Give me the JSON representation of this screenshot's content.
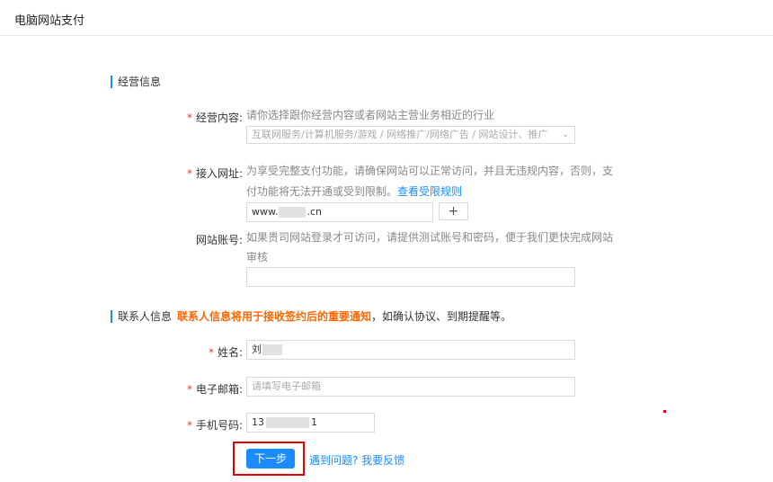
{
  "header": {
    "title": "电脑网站支付"
  },
  "business_section": {
    "title": "经营信息"
  },
  "business_content": {
    "required_mark": "*",
    "label": "经营内容:",
    "hint": "请你选择跟你经营内容或者网站主营业务相近的行业",
    "select_value": "互联网服务/计算机服务/游戏 / 网络推广/网络广告 / 网站设计、推广",
    "caret": "⌄"
  },
  "website_url": {
    "required_mark": "*",
    "label": "接入网址:",
    "hint_line1": "为享受完整支付功能，请确保网站可以正常访问，并且无违规内容，否则，支",
    "hint_line2": "付功能将无法开通或受到限制。",
    "link": "查看受限规则",
    "value_prefix": "www.",
    "value_suffix": ".cn",
    "add_label": "+"
  },
  "website_account": {
    "label": "网站账号:",
    "hint_line1": "如果贵司网站登录才可访问，请提供测试账号和密码，便于我们更快完成网站",
    "hint_line2": "审核",
    "value": ""
  },
  "contact_section": {
    "title": "联系人信息",
    "notice": "联系人信息将用于接收签约后的重要通知",
    "notice_rest": "，如确认协议、到期提醒等。"
  },
  "contact_name": {
    "required_mark": "*",
    "label": "姓名:",
    "value": "刘"
  },
  "contact_email": {
    "required_mark": "*",
    "label": "电子邮箱:",
    "placeholder": "请填写电子邮箱"
  },
  "contact_phone": {
    "required_mark": "*",
    "label": "手机号码:",
    "value_prefix": "13",
    "value_suffix": "1"
  },
  "actions": {
    "next_label": "下一步",
    "feedback_link": "遇到问题? 我要反馈"
  },
  "colors": {
    "accent": "#1a8cff",
    "required": "#e4393c",
    "notice": "#ff6600",
    "highlight": "#e60000"
  }
}
